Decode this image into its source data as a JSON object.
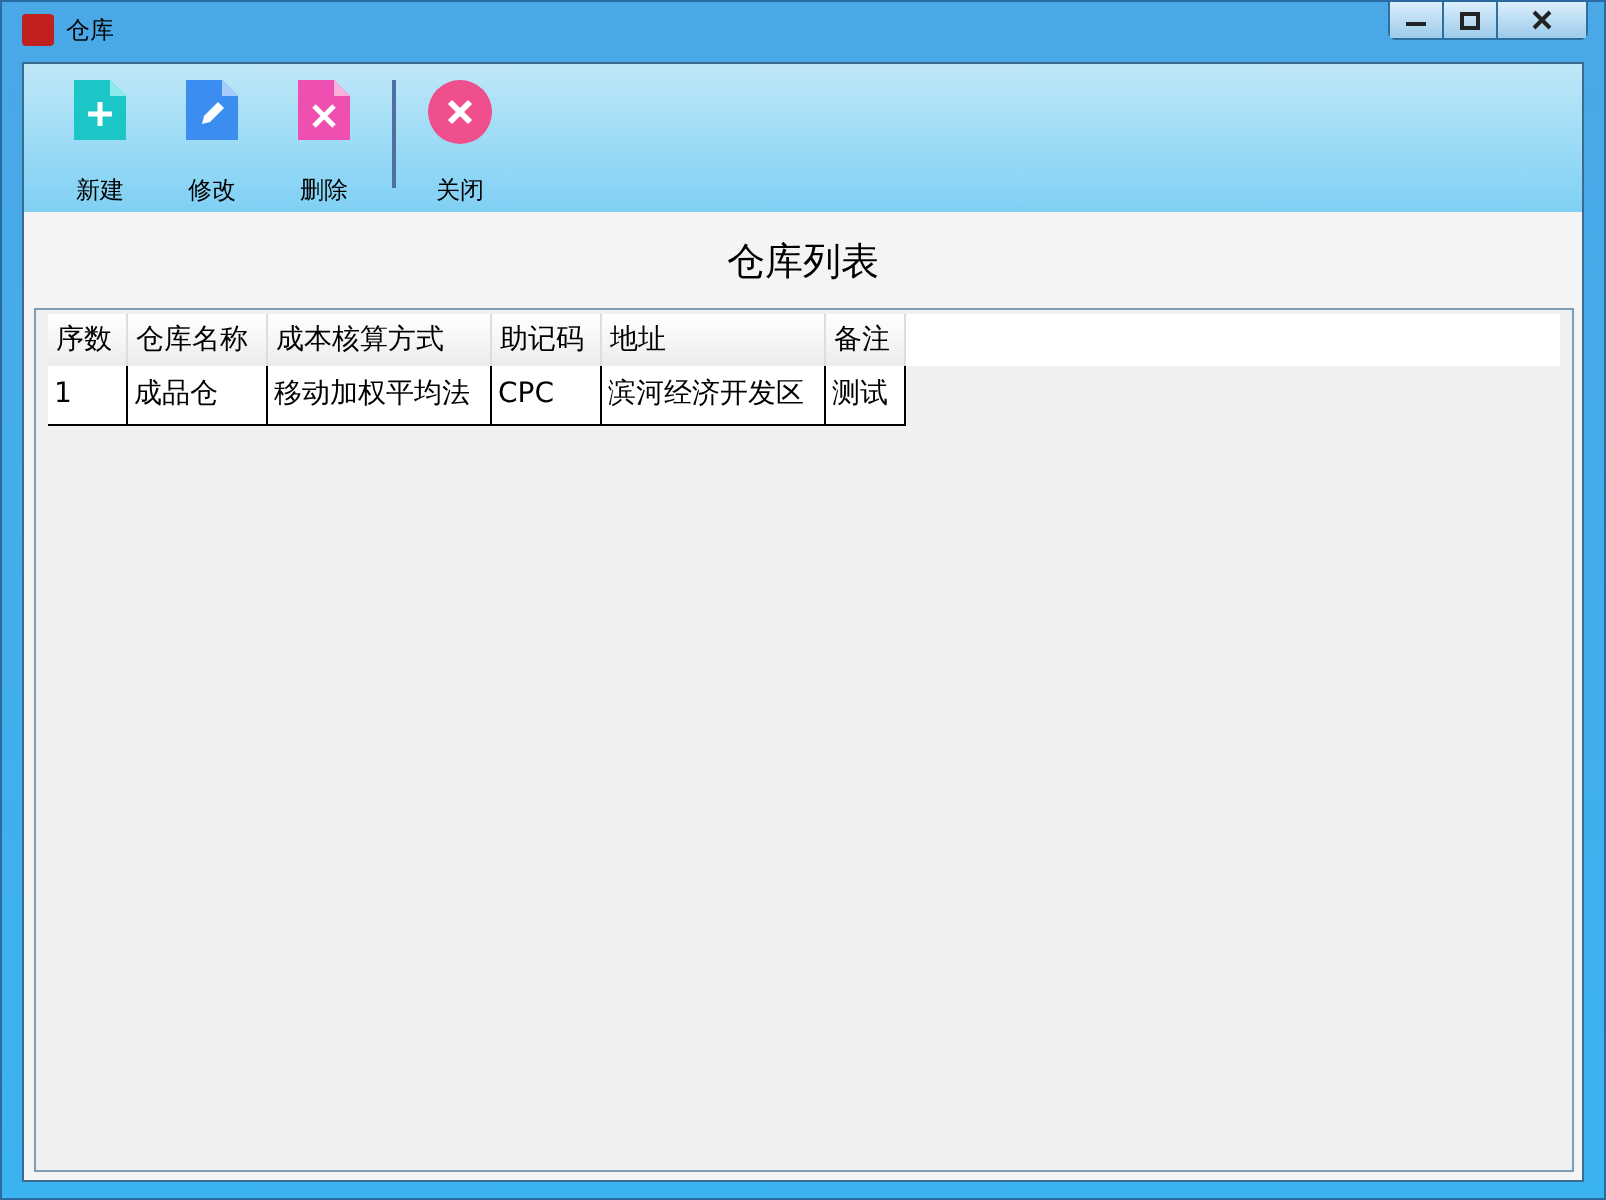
{
  "window": {
    "title": "仓库"
  },
  "toolbar": [
    {
      "label": "新建",
      "kind": "new"
    },
    {
      "label": "修改",
      "kind": "edit"
    },
    {
      "label": "删除",
      "kind": "delete"
    },
    {
      "label": "关闭",
      "kind": "close"
    }
  ],
  "heading": "仓库列表",
  "table": {
    "columns": [
      "序数",
      "仓库名称",
      "成本核算方式",
      "助记码",
      "地址",
      "备注"
    ],
    "rows": [
      [
        "1",
        "成品仓",
        "移动加权平均法",
        "CPC",
        "滨河经济开发区",
        "测试"
      ]
    ]
  }
}
